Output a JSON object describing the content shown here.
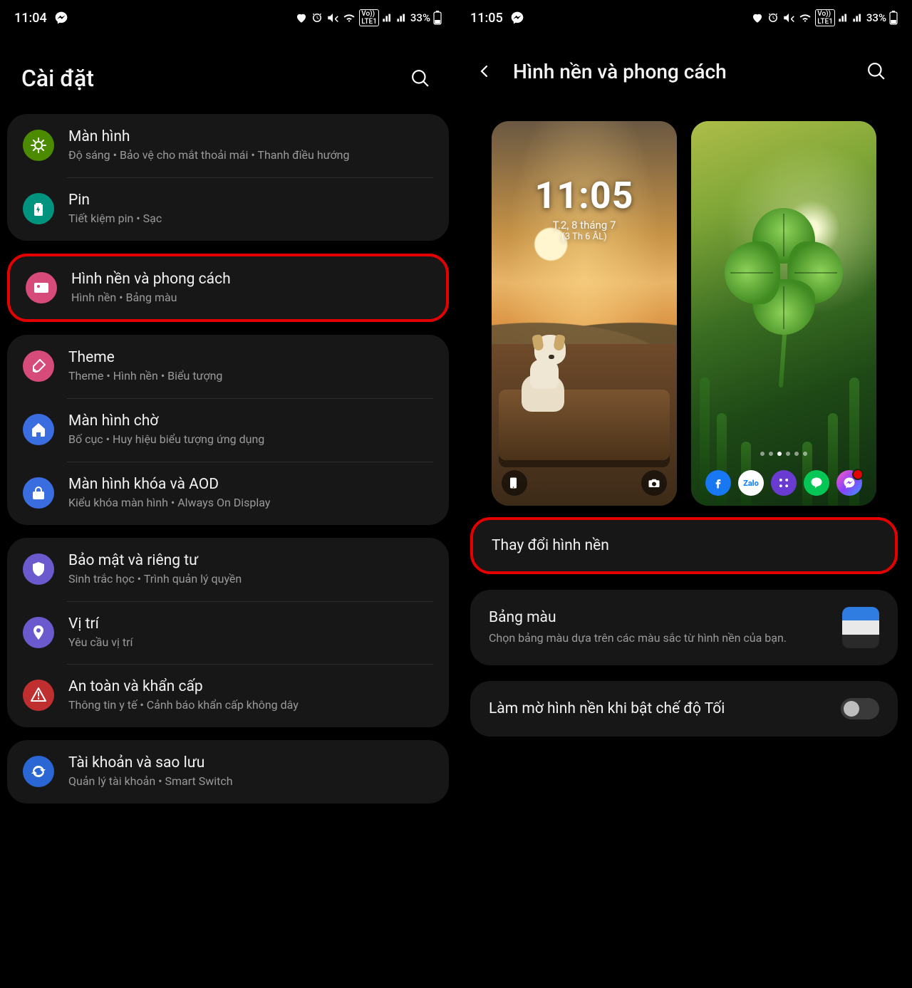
{
  "left": {
    "status": {
      "time": "11:04",
      "battery": "33%"
    },
    "title": "Cài đặt",
    "groups": [
      {
        "highlight": false,
        "rows": [
          {
            "icon": "brightness",
            "color": "ic-green",
            "title": "Màn hình",
            "sub": "Độ sáng  •  Bảo vệ cho mắt thoải mái  •  Thanh điều hướng"
          },
          {
            "icon": "battery",
            "color": "ic-teal",
            "title": "Pin",
            "sub": "Tiết kiệm pin  •  Sạc"
          }
        ]
      },
      {
        "highlight": true,
        "rows": [
          {
            "icon": "image",
            "color": "ic-pink",
            "title": "Hình nền và phong cách",
            "sub": "Hình nền  •  Bảng màu"
          }
        ]
      },
      {
        "highlight": false,
        "rows": [
          {
            "icon": "brush",
            "color": "ic-pink2",
            "title": "Theme",
            "sub": "Theme  •  Hình nền  •  Biểu tượng"
          },
          {
            "icon": "home",
            "color": "ic-blue",
            "title": "Màn hình chờ",
            "sub": "Bố cục  •  Huy hiệu biểu tượng ứng dụng"
          },
          {
            "icon": "lock",
            "color": "ic-blue2",
            "title": "Màn hình khóa và AOD",
            "sub": "Kiểu khóa màn hình  •  Always On Display"
          }
        ]
      },
      {
        "highlight": false,
        "rows": [
          {
            "icon": "shield",
            "color": "ic-purple",
            "title": "Bảo mật và riêng tư",
            "sub": "Sinh trắc học  •  Trình quản lý quyền"
          },
          {
            "icon": "pin",
            "color": "ic-purple2",
            "title": "Vị trí",
            "sub": "Yêu cầu vị trí"
          },
          {
            "icon": "alert",
            "color": "ic-red",
            "title": "An toàn và khẩn cấp",
            "sub": "Thông tin y tế  •  Cảnh báo khẩn cấp không dây"
          }
        ]
      },
      {
        "highlight": false,
        "rows": [
          {
            "icon": "sync",
            "color": "ic-cyan",
            "title": "Tài khoản và sao lưu",
            "sub": "Quản lý tài khoản  •  Smart Switch"
          }
        ]
      }
    ]
  },
  "right": {
    "status": {
      "time": "11:05",
      "battery": "33%"
    },
    "title": "Hình nền và phong cách",
    "lock": {
      "time": "11:05",
      "date1": "T.2, 8 tháng 7",
      "date2": "(3 Th 6 ÂL)"
    },
    "home_apps": [
      "app-fb",
      "app-zalo",
      "app-grid",
      "app-line",
      "app-msg"
    ],
    "change_label": "Thay đổi hình nền",
    "palette": {
      "title": "Bảng màu",
      "sub": "Chọn bảng màu dựa trên các màu sắc từ hình nền của bạn.",
      "colors": [
        "#2f7de1",
        "#e9e9e9",
        "#2a2a2a"
      ]
    },
    "dim": {
      "title": "Làm mờ hình nền khi bật chế độ Tối",
      "on": false
    }
  }
}
